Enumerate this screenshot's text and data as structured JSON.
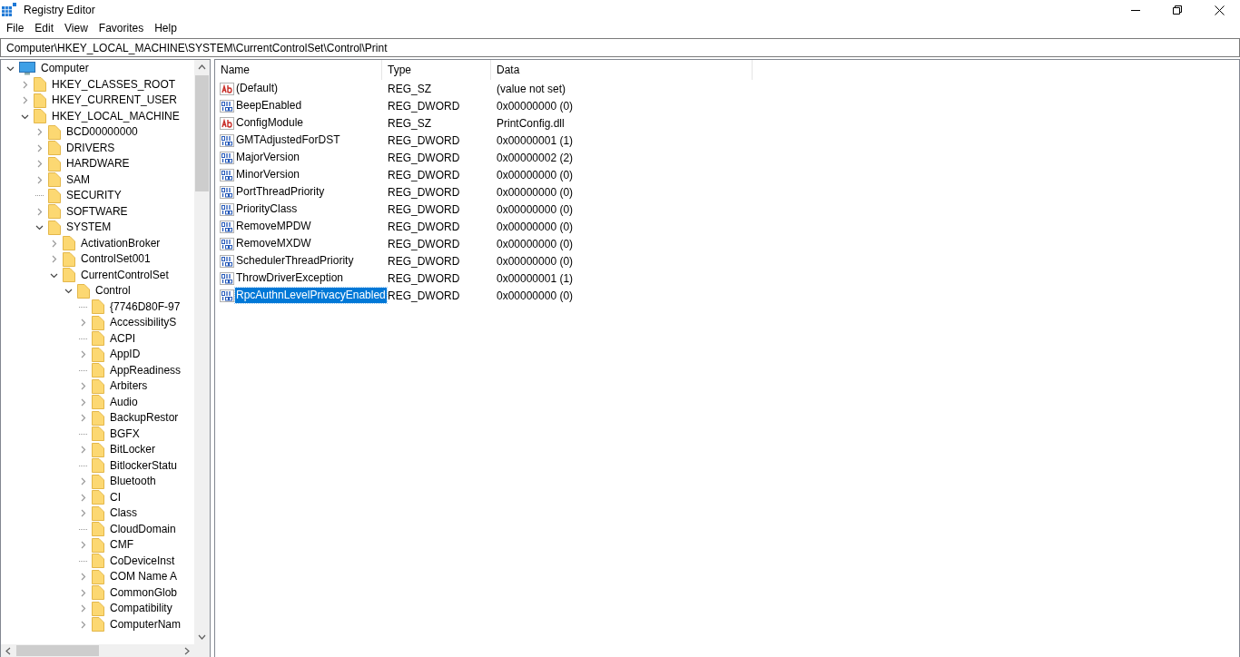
{
  "window": {
    "title": "Registry Editor"
  },
  "menu": [
    "File",
    "Edit",
    "View",
    "Favorites",
    "Help"
  ],
  "address": "Computer\\HKEY_LOCAL_MACHINE\\SYSTEM\\CurrentControlSet\\Control\\Print",
  "tree": [
    {
      "label": "Computer",
      "kind": "computer",
      "expandable": true,
      "expanded": true,
      "children": [
        {
          "label": "HKEY_CLASSES_ROOT",
          "kind": "folder",
          "expandable": true,
          "expanded": false
        },
        {
          "label": "HKEY_CURRENT_USER",
          "kind": "folder",
          "expandable": true,
          "expanded": false
        },
        {
          "label": "HKEY_LOCAL_MACHINE",
          "kind": "folder",
          "expandable": true,
          "expanded": true,
          "children": [
            {
              "label": "BCD00000000",
              "kind": "folder",
              "expandable": true,
              "expanded": false
            },
            {
              "label": "DRIVERS",
              "kind": "folder",
              "expandable": true,
              "expanded": false
            },
            {
              "label": "HARDWARE",
              "kind": "folder",
              "expandable": true,
              "expanded": false
            },
            {
              "label": "SAM",
              "kind": "folder",
              "expandable": true,
              "expanded": false
            },
            {
              "label": "SECURITY",
              "kind": "folder",
              "expandable": false,
              "expanded": false
            },
            {
              "label": "SOFTWARE",
              "kind": "folder",
              "expandable": true,
              "expanded": false
            },
            {
              "label": "SYSTEM",
              "kind": "folder",
              "expandable": true,
              "expanded": true,
              "children": [
                {
                  "label": "ActivationBroker",
                  "kind": "folder",
                  "expandable": true,
                  "expanded": false
                },
                {
                  "label": "ControlSet001",
                  "kind": "folder",
                  "expandable": true,
                  "expanded": false
                },
                {
                  "label": "CurrentControlSet",
                  "kind": "folder",
                  "expandable": true,
                  "expanded": true,
                  "children": [
                    {
                      "label": "Control",
                      "kind": "folder",
                      "expandable": true,
                      "expanded": true,
                      "children": [
                        {
                          "label": "{7746D80F-97",
                          "kind": "folder",
                          "expandable": false,
                          "expanded": false
                        },
                        {
                          "label": "AccessibilityS",
                          "kind": "folder",
                          "expandable": true,
                          "expanded": false
                        },
                        {
                          "label": "ACPI",
                          "kind": "folder",
                          "expandable": false,
                          "expanded": false
                        },
                        {
                          "label": "AppID",
                          "kind": "folder",
                          "expandable": true,
                          "expanded": false
                        },
                        {
                          "label": "AppReadiness",
                          "kind": "folder",
                          "expandable": false,
                          "expanded": false
                        },
                        {
                          "label": "Arbiters",
                          "kind": "folder",
                          "expandable": true,
                          "expanded": false
                        },
                        {
                          "label": "Audio",
                          "kind": "folder",
                          "expandable": true,
                          "expanded": false
                        },
                        {
                          "label": "BackupRestor",
                          "kind": "folder",
                          "expandable": true,
                          "expanded": false
                        },
                        {
                          "label": "BGFX",
                          "kind": "folder",
                          "expandable": false,
                          "expanded": false
                        },
                        {
                          "label": "BitLocker",
                          "kind": "folder",
                          "expandable": true,
                          "expanded": false
                        },
                        {
                          "label": "BitlockerStatu",
                          "kind": "folder",
                          "expandable": false,
                          "expanded": false
                        },
                        {
                          "label": "Bluetooth",
                          "kind": "folder",
                          "expandable": true,
                          "expanded": false
                        },
                        {
                          "label": "CI",
                          "kind": "folder",
                          "expandable": true,
                          "expanded": false
                        },
                        {
                          "label": "Class",
                          "kind": "folder",
                          "expandable": true,
                          "expanded": false
                        },
                        {
                          "label": "CloudDomain",
                          "kind": "folder",
                          "expandable": false,
                          "expanded": false
                        },
                        {
                          "label": "CMF",
                          "kind": "folder",
                          "expandable": true,
                          "expanded": false
                        },
                        {
                          "label": "CoDeviceInst",
                          "kind": "folder",
                          "expandable": false,
                          "expanded": false
                        },
                        {
                          "label": "COM Name A",
                          "kind": "folder",
                          "expandable": true,
                          "expanded": false
                        },
                        {
                          "label": "CommonGlob",
                          "kind": "folder",
                          "expandable": true,
                          "expanded": false
                        },
                        {
                          "label": "Compatibility",
                          "kind": "folder",
                          "expandable": true,
                          "expanded": false
                        },
                        {
                          "label": "ComputerNam",
                          "kind": "folder",
                          "expandable": true,
                          "expanded": false
                        }
                      ]
                    }
                  ]
                }
              ]
            }
          ]
        }
      ]
    }
  ],
  "table": {
    "columns": [
      "Name",
      "Type",
      "Data"
    ],
    "rows": [
      {
        "name": "(Default)",
        "type": "REG_SZ",
        "data": "(value not set)",
        "kind": "string",
        "selected": false
      },
      {
        "name": "BeepEnabled",
        "type": "REG_DWORD",
        "data": "0x00000000 (0)",
        "kind": "number",
        "selected": false
      },
      {
        "name": "ConfigModule",
        "type": "REG_SZ",
        "data": "PrintConfig.dll",
        "kind": "string",
        "selected": false
      },
      {
        "name": "GMTAdjustedForDST",
        "type": "REG_DWORD",
        "data": "0x00000001 (1)",
        "kind": "number",
        "selected": false
      },
      {
        "name": "MajorVersion",
        "type": "REG_DWORD",
        "data": "0x00000002 (2)",
        "kind": "number",
        "selected": false
      },
      {
        "name": "MinorVersion",
        "type": "REG_DWORD",
        "data": "0x00000000 (0)",
        "kind": "number",
        "selected": false
      },
      {
        "name": "PortThreadPriority",
        "type": "REG_DWORD",
        "data": "0x00000000 (0)",
        "kind": "number",
        "selected": false
      },
      {
        "name": "PriorityClass",
        "type": "REG_DWORD",
        "data": "0x00000000 (0)",
        "kind": "number",
        "selected": false
      },
      {
        "name": "RemoveMPDW",
        "type": "REG_DWORD",
        "data": "0x00000000 (0)",
        "kind": "number",
        "selected": false
      },
      {
        "name": "RemoveMXDW",
        "type": "REG_DWORD",
        "data": "0x00000000 (0)",
        "kind": "number",
        "selected": false
      },
      {
        "name": "SchedulerThreadPriority",
        "type": "REG_DWORD",
        "data": "0x00000000 (0)",
        "kind": "number",
        "selected": false
      },
      {
        "name": "ThrowDriverException",
        "type": "REG_DWORD",
        "data": "0x00000001 (1)",
        "kind": "number",
        "selected": false
      },
      {
        "name": "RpcAuthnLevelPrivacyEnabled",
        "type": "REG_DWORD",
        "data": "0x00000000 (0)",
        "kind": "number",
        "selected": true
      }
    ]
  }
}
